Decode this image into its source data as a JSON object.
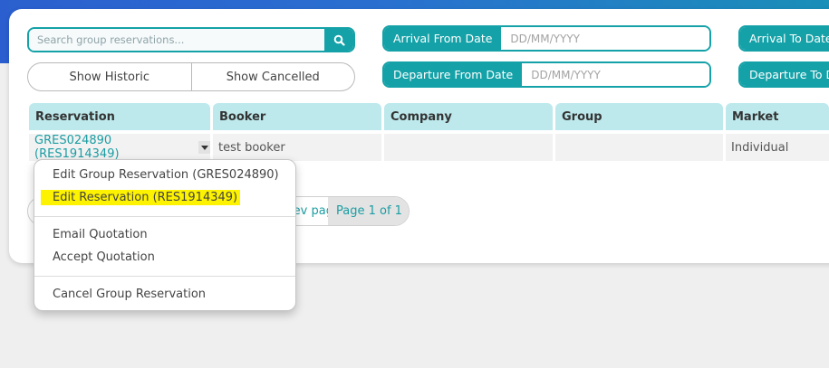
{
  "search": {
    "placeholder": "Search group reservations..."
  },
  "filters": {
    "show_historic": "Show Historic",
    "show_cancelled": "Show Cancelled",
    "arrival_from_label": "Arrival From Date",
    "arrival_to_label": "Arrival To Date",
    "departure_from_label": "Departure From Date",
    "departure_to_label": "Departure To Date",
    "date_placeholder": "DD/MM/YYYY"
  },
  "table": {
    "columns": [
      "Reservation",
      "Booker",
      "Company",
      "Group",
      "Market"
    ],
    "rows": [
      {
        "reservation": "GRES024890 (RES1914349)",
        "booker": "test booker",
        "company": "",
        "group": "",
        "market": "Individual"
      }
    ]
  },
  "pagination": {
    "prev_label": "Prev page",
    "page_info": "Page 1 of 1"
  },
  "context_menu": {
    "items": [
      "Edit Group Reservation (GRES024890)",
      "Edit Reservation (RES1914349)",
      "Email Quotation",
      "Accept Quotation",
      "Cancel Group Reservation"
    ]
  },
  "colors": {
    "accent": "#14a2a8",
    "header_bg": "#bde9ec",
    "highlight": "#fdf200"
  }
}
